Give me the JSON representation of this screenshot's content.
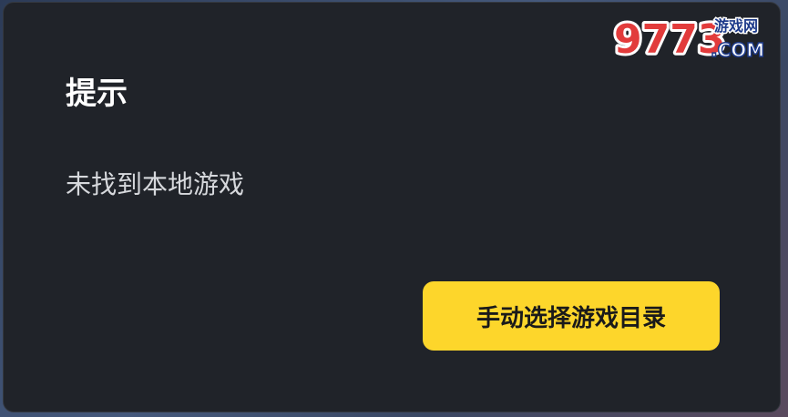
{
  "dialog": {
    "title": "提示",
    "message": "未找到本地游戏",
    "action_label": "手动选择游戏目录"
  },
  "watermark": {
    "digits": "9773",
    "tagline": "游戏网",
    "domain": ".COM"
  },
  "colors": {
    "dialog_bg": "#202329",
    "title": "#ffffff",
    "message": "#d6d8dc",
    "button_bg": "#fdd62b",
    "button_text": "#1a1a1a"
  }
}
